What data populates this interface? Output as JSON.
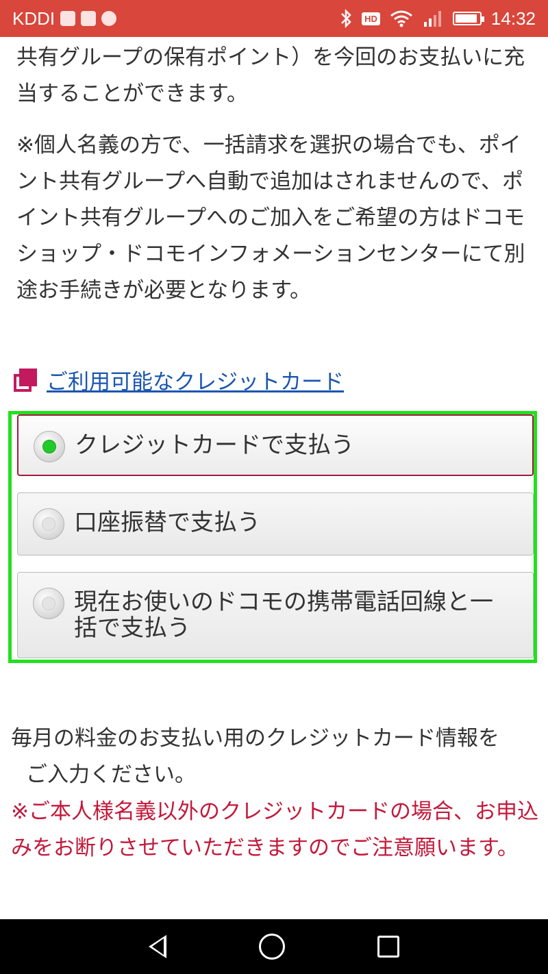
{
  "status_bar": {
    "carrier": "KDDI",
    "hd_badge": "HD",
    "time": "14:32",
    "battery_level": 0.9,
    "icons": [
      "notification-app-icon",
      "lifelog-icon",
      "slack-icon",
      "bluetooth-icon",
      "wifi-icon",
      "signal-icon",
      "battery-icon"
    ]
  },
  "content": {
    "paragraph_1": "共有グループの保有ポイント）を今回のお支払いに充当することができます。",
    "paragraph_2": "※個人名義の方で、一括請求を選択の場合でも、ポイント共有グループへ自動で追加はされませんので、ポイント共有グループへのご加入をご希望の方はドコモショップ・ドコモインフォメーションセンターにて別途お手続きが必要となります。",
    "credit_card_link": "ご利用可能なクレジットカード"
  },
  "payment_options": [
    {
      "label": "クレジットカードで支払う",
      "selected": true
    },
    {
      "label": "口座振替で支払う",
      "selected": false
    },
    {
      "label": "現在お使いのドコモの携帯電話回線と一括で支払う",
      "selected": false
    }
  ],
  "instructions": {
    "line_1": "毎月の料金のお支払い用のクレジットカード情報を",
    "line_2": "ご入力ください。",
    "warning_prefix": "※",
    "warning_text": "ご本人様名義以外のクレジットカードの場合、お申込みをお断りさせていただきますのでご注意願います。"
  },
  "colors": {
    "status_bar": "#d9463b",
    "link": "#1a56b0",
    "warning": "#c3193a",
    "highlight_border": "#22e01e",
    "selected_radio": "#22c92a"
  },
  "nav_bar": {
    "icons": [
      "back-icon",
      "home-icon",
      "recent-apps-icon"
    ]
  }
}
